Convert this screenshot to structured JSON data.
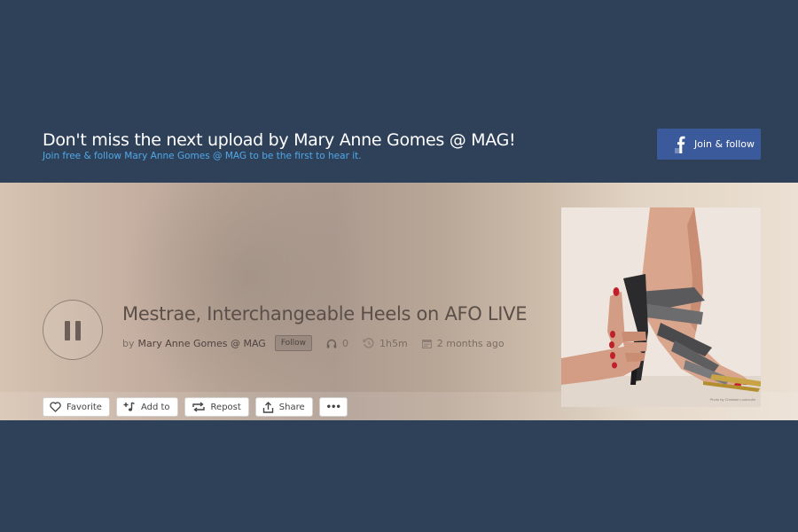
{
  "banner": {
    "headline": "Don't miss the next upload by Mary Anne Gomes @ MAG!",
    "subtext": "Join free & follow Mary Anne Gomes @ MAG to be the first to hear it.",
    "join_button_label": "Join & follow",
    "join_button_icon": "facebook-icon"
  },
  "track": {
    "title": "Mestrae, Interchangeable Heels on AFO LIVE",
    "by_label": "by",
    "author": "Mary Anne Gomes @ MAG",
    "follow_label": "Follow",
    "plays": "0",
    "duration": "1h5m",
    "uploaded": "2 months ago",
    "state": "playing",
    "artwork_caption": "Photo by Christian Louboutin"
  },
  "actions": {
    "favorite": "Favorite",
    "add_to": "Add to",
    "repost": "Repost",
    "share": "Share",
    "more": "•••"
  },
  "colors": {
    "background": "#2f4159",
    "accent_link": "#4fa8e8",
    "facebook": "#3b5a9c"
  }
}
